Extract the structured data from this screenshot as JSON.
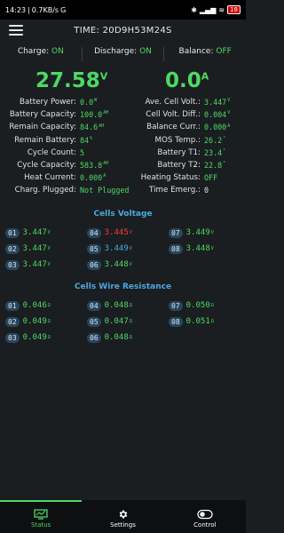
{
  "statusbar": {
    "time": "14:23",
    "speed": "0.7KB/s",
    "g": "G",
    "battery": "18"
  },
  "header": {
    "title": "TIME: 20D9H53M24S"
  },
  "flags": [
    {
      "label": "Charge:",
      "value": "ON"
    },
    {
      "label": "Discharge:",
      "value": "ON"
    },
    {
      "label": "Balance:",
      "value": "OFF"
    }
  ],
  "big": {
    "voltage": "27.58",
    "voltage_unit": "V",
    "current": "0.0",
    "current_unit": "A"
  },
  "left_rows": [
    {
      "label": "Battery Power:",
      "value": "0.0",
      "unit": "W"
    },
    {
      "label": "Battery Capacity:",
      "value": "100.0",
      "unit": "AH"
    },
    {
      "label": "Remain Capacity:",
      "value": "84.6",
      "unit": "AH"
    },
    {
      "label": "Remain Battery:",
      "value": "84",
      "unit": "%"
    },
    {
      "label": "Cycle Count:",
      "value": "5",
      "unit": ""
    },
    {
      "label": "Cycle Capacity:",
      "value": "583.8",
      "unit": "AH"
    },
    {
      "label": "Heat Current:",
      "value": "0.000",
      "unit": "A"
    },
    {
      "label": "Charg. Plugged:",
      "value": "Not Plugged",
      "unit": ""
    }
  ],
  "right_rows": [
    {
      "label": "Ave. Cell Volt.:",
      "value": "3.447",
      "unit": "V"
    },
    {
      "label": "Cell Volt. Diff.:",
      "value": "0.004",
      "unit": "V"
    },
    {
      "label": "Balance Curr.:",
      "value": "0.000",
      "unit": "A"
    },
    {
      "label": "MOS Temp.:",
      "value": "26.2",
      "unit": "°"
    },
    {
      "label": "Battery T1:",
      "value": "23.4",
      "unit": "°"
    },
    {
      "label": "Battery T2:",
      "value": "22.8",
      "unit": "°"
    },
    {
      "label": "Heating Status:",
      "value": "OFF",
      "unit": ""
    },
    {
      "label": "Time Emerg.:",
      "value": "0",
      "unit": ""
    }
  ],
  "cells_voltage": {
    "title": "Cells Voltage",
    "cells": [
      {
        "idx": "01",
        "value": "3.447",
        "unit": "V",
        "color": "#4cd964"
      },
      {
        "idx": "04",
        "value": "3.445",
        "unit": "V",
        "color": "#ff3b30"
      },
      {
        "idx": "07",
        "value": "3.449",
        "unit": "V",
        "color": "#4cd964"
      },
      {
        "idx": "02",
        "value": "3.447",
        "unit": "V",
        "color": "#4cd964"
      },
      {
        "idx": "05",
        "value": "3.449",
        "unit": "V",
        "color": "#4aa8e0"
      },
      {
        "idx": "08",
        "value": "3.448",
        "unit": "V",
        "color": "#4cd964"
      },
      {
        "idx": "03",
        "value": "3.447",
        "unit": "V",
        "color": "#4cd964"
      },
      {
        "idx": "06",
        "value": "3.448",
        "unit": "V",
        "color": "#4cd964"
      }
    ]
  },
  "cells_resistance": {
    "title": "Cells Wire Resistance",
    "cells": [
      {
        "idx": "01",
        "value": "0.046",
        "unit": "Ω"
      },
      {
        "idx": "04",
        "value": "0.048",
        "unit": "Ω"
      },
      {
        "idx": "07",
        "value": "0.050",
        "unit": "Ω"
      },
      {
        "idx": "02",
        "value": "0.049",
        "unit": "Ω"
      },
      {
        "idx": "05",
        "value": "0.047",
        "unit": "Ω"
      },
      {
        "idx": "08",
        "value": "0.051",
        "unit": "Ω"
      },
      {
        "idx": "03",
        "value": "0.049",
        "unit": "Ω"
      },
      {
        "idx": "06",
        "value": "0.048",
        "unit": "Ω"
      }
    ]
  },
  "nav": [
    {
      "label": "Status",
      "icon": "monitor-icon"
    },
    {
      "label": "Settings",
      "icon": "gear-icon"
    },
    {
      "label": "Control",
      "icon": "toggle-icon"
    }
  ],
  "colors": {
    "accent": "#4cd964",
    "alert": "#ff3b30",
    "section": "#4aa8e0",
    "background": "#1b1e21"
  }
}
